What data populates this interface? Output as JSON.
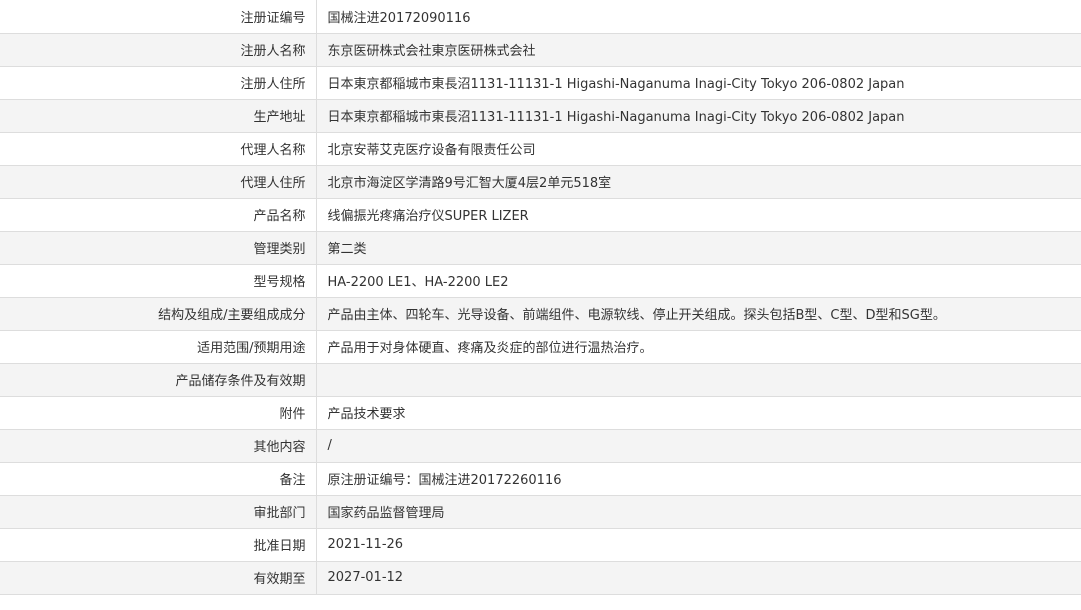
{
  "rows": [
    {
      "label": "注册证编号",
      "value": "国械注进20172090116"
    },
    {
      "label": "注册人名称",
      "value": "东京医研株式会社東京医研株式会社"
    },
    {
      "label": "注册人住所",
      "value": "日本東京都稲城市東長沼1131-11131-1 Higashi-Naganuma Inagi-City Tokyo 206-0802 Japan"
    },
    {
      "label": "生产地址",
      "value": "日本東京都稲城市東長沼1131-11131-1 Higashi-Naganuma Inagi-City Tokyo 206-0802 Japan"
    },
    {
      "label": "代理人名称",
      "value": "北京安蒂艾克医疗设备有限责任公司"
    },
    {
      "label": "代理人住所",
      "value": "北京市海淀区学清路9号汇智大厦4层2单元518室"
    },
    {
      "label": "产品名称",
      "value": "线偏振光疼痛治疗仪SUPER LIZER"
    },
    {
      "label": "管理类别",
      "value": "第二类"
    },
    {
      "label": "型号规格",
      "value": "HA-2200 LE1、HA-2200 LE2"
    },
    {
      "label": "结构及组成/主要组成成分",
      "value": "产品由主体、四轮车、光导设备、前端组件、电源软线、停止开关组成。探头包括B型、C型、D型和SG型。"
    },
    {
      "label": "适用范围/预期用途",
      "value": "产品用于对身体硬直、疼痛及炎症的部位进行温热治疗。"
    },
    {
      "label": "产品储存条件及有效期",
      "value": ""
    },
    {
      "label": "附件",
      "value": "产品技术要求"
    },
    {
      "label": "其他内容",
      "value": "/"
    },
    {
      "label": "备注",
      "value": "原注册证编号：国械注进20172260116"
    },
    {
      "label": "审批部门",
      "value": "国家药品监督管理局"
    },
    {
      "label": "批准日期",
      "value": "2021-11-26"
    },
    {
      "label": "有效期至",
      "value": "2027-01-12"
    }
  ]
}
